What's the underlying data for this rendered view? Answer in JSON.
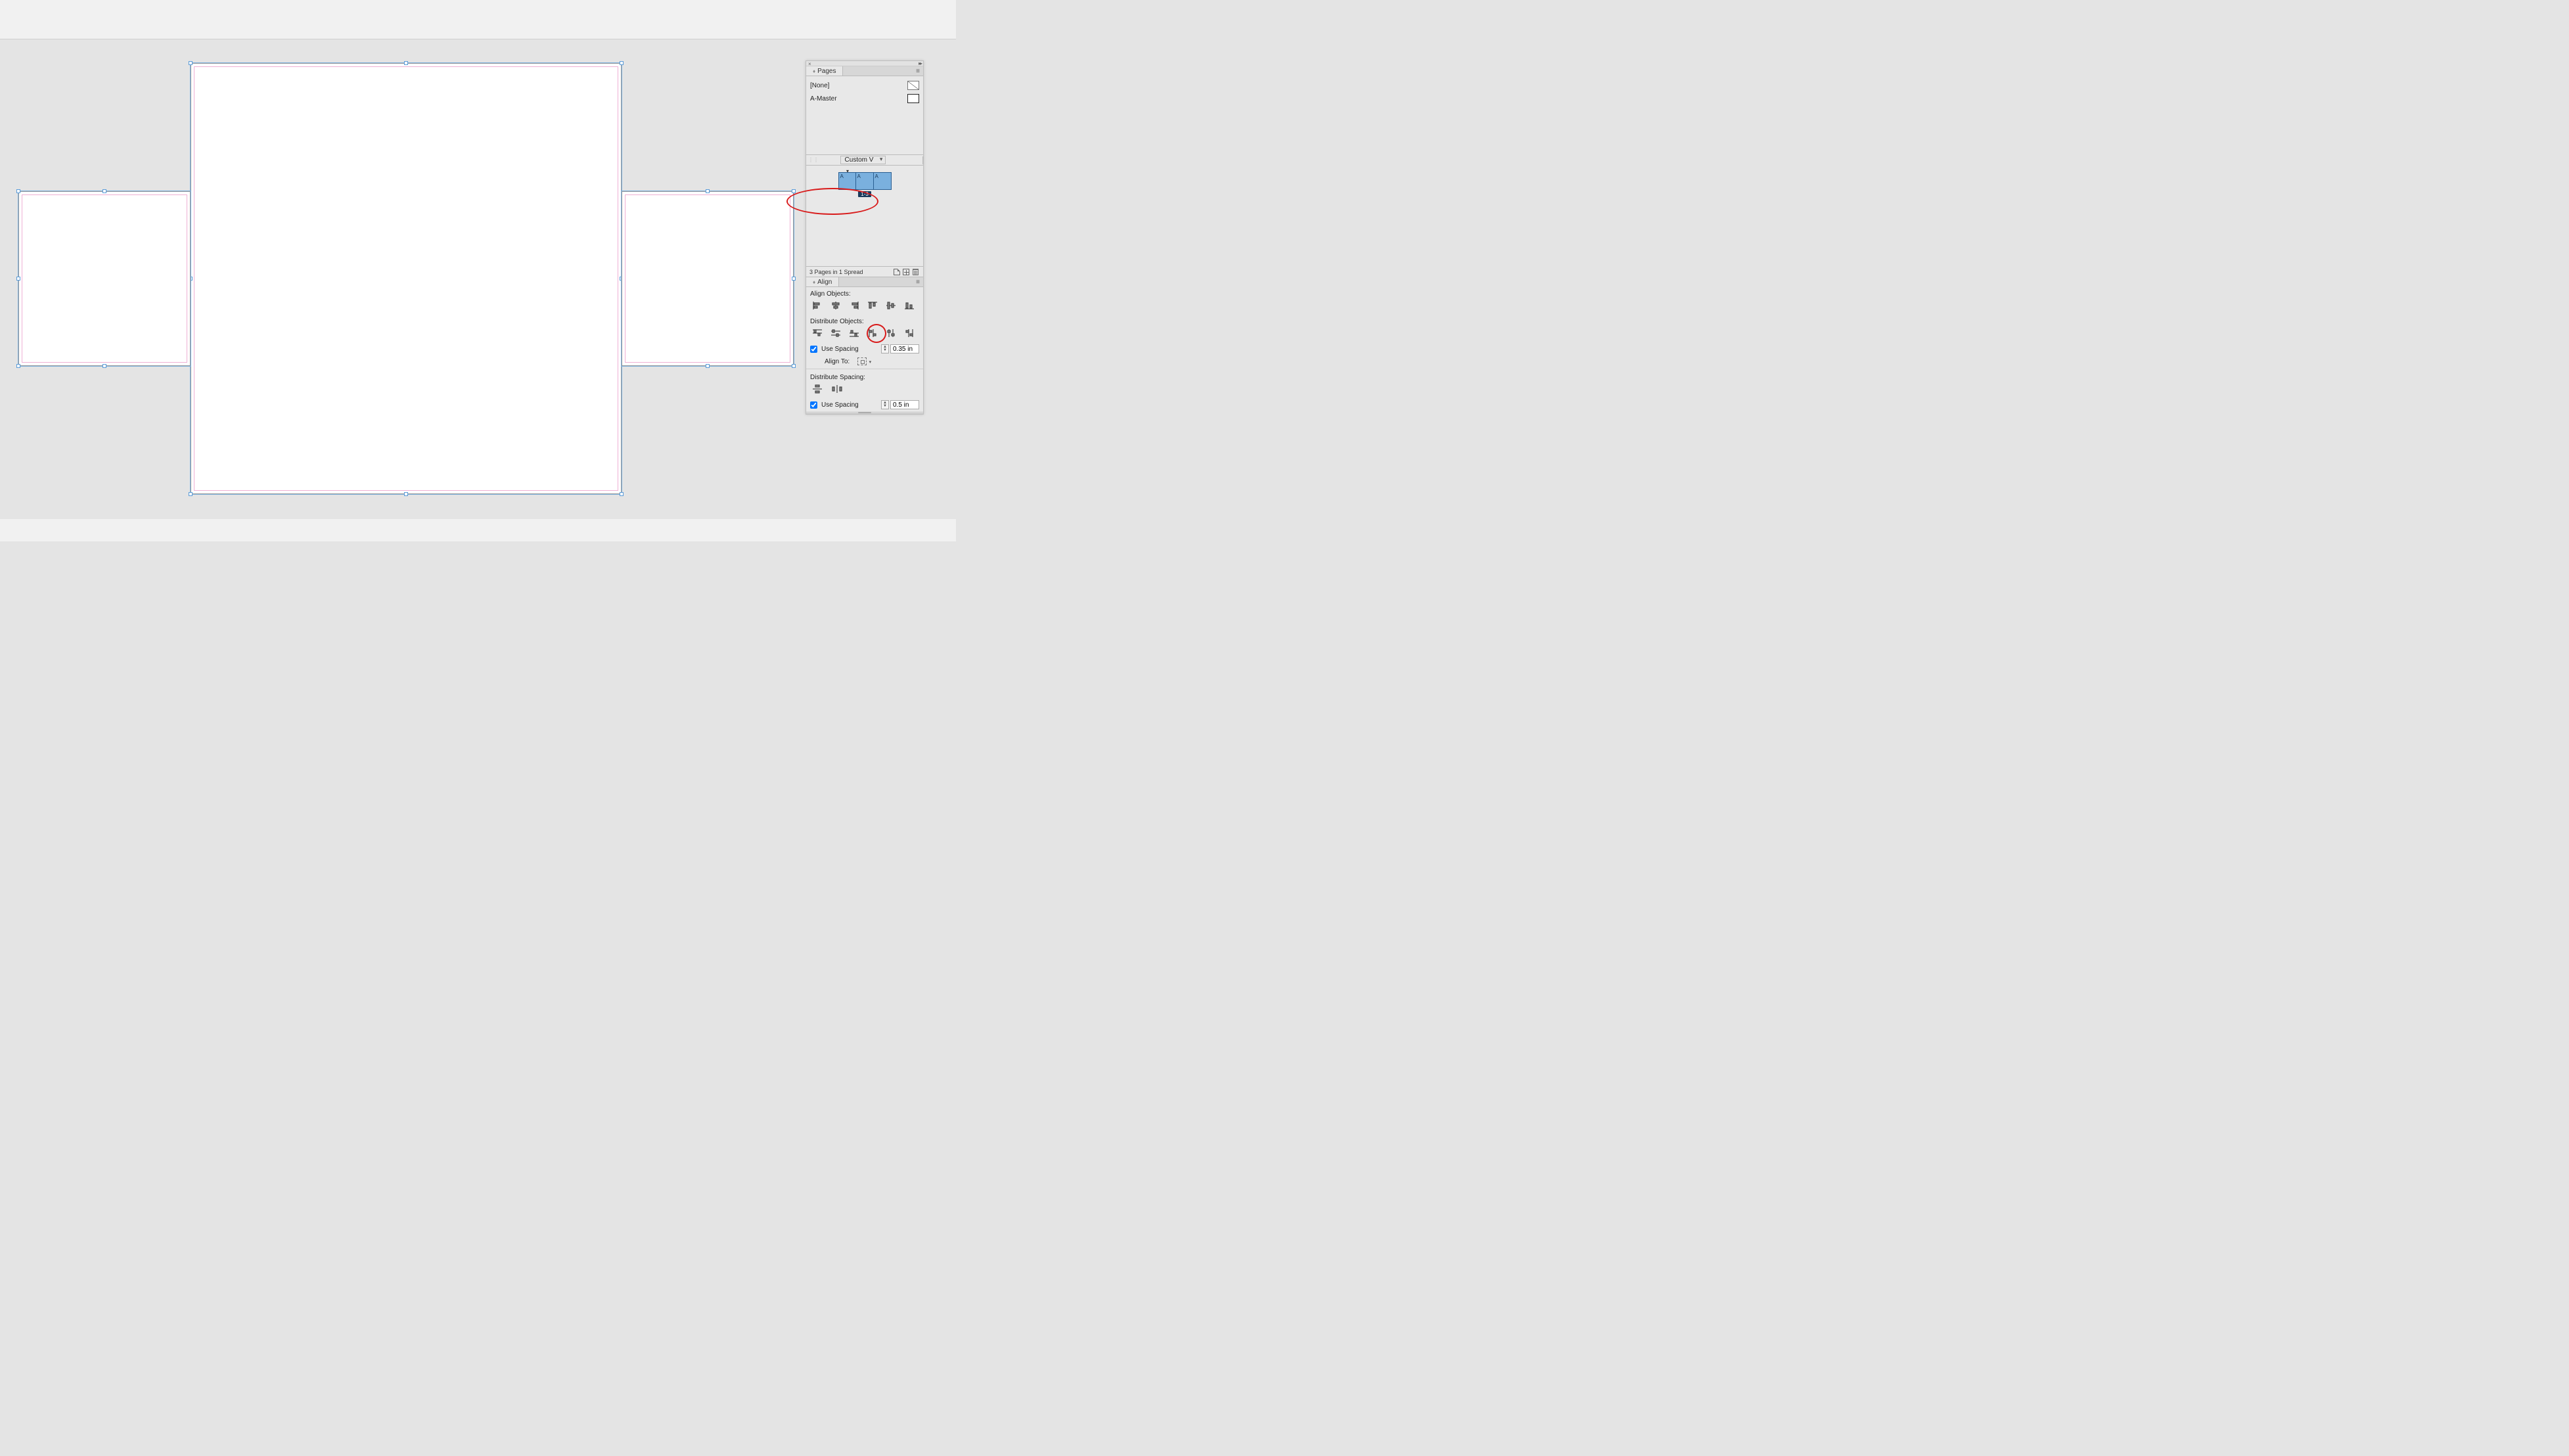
{
  "pages_panel": {
    "tab_label": "Pages",
    "masters": [
      {
        "label": "[None]"
      },
      {
        "label": "A-Master"
      }
    ],
    "page_size_dropdown": "Custom V",
    "spread_page_labels": [
      "A",
      "A",
      "A"
    ],
    "spread_range_label": "1-3",
    "status_text": "3 Pages in 1 Spread"
  },
  "align_panel": {
    "tab_label": "Align",
    "section_align_objects": "Align Objects:",
    "section_distribute_objects": "Distribute Objects:",
    "use_spacing_1_label": "Use Spacing",
    "use_spacing_1_value": "0.35 in",
    "align_to_label": "Align To:",
    "section_distribute_spacing": "Distribute Spacing:",
    "use_spacing_2_label": "Use Spacing",
    "use_spacing_2_value": "0.5 in"
  },
  "canvas": {
    "pages": [
      "center-large",
      "left-small",
      "right-small"
    ]
  }
}
